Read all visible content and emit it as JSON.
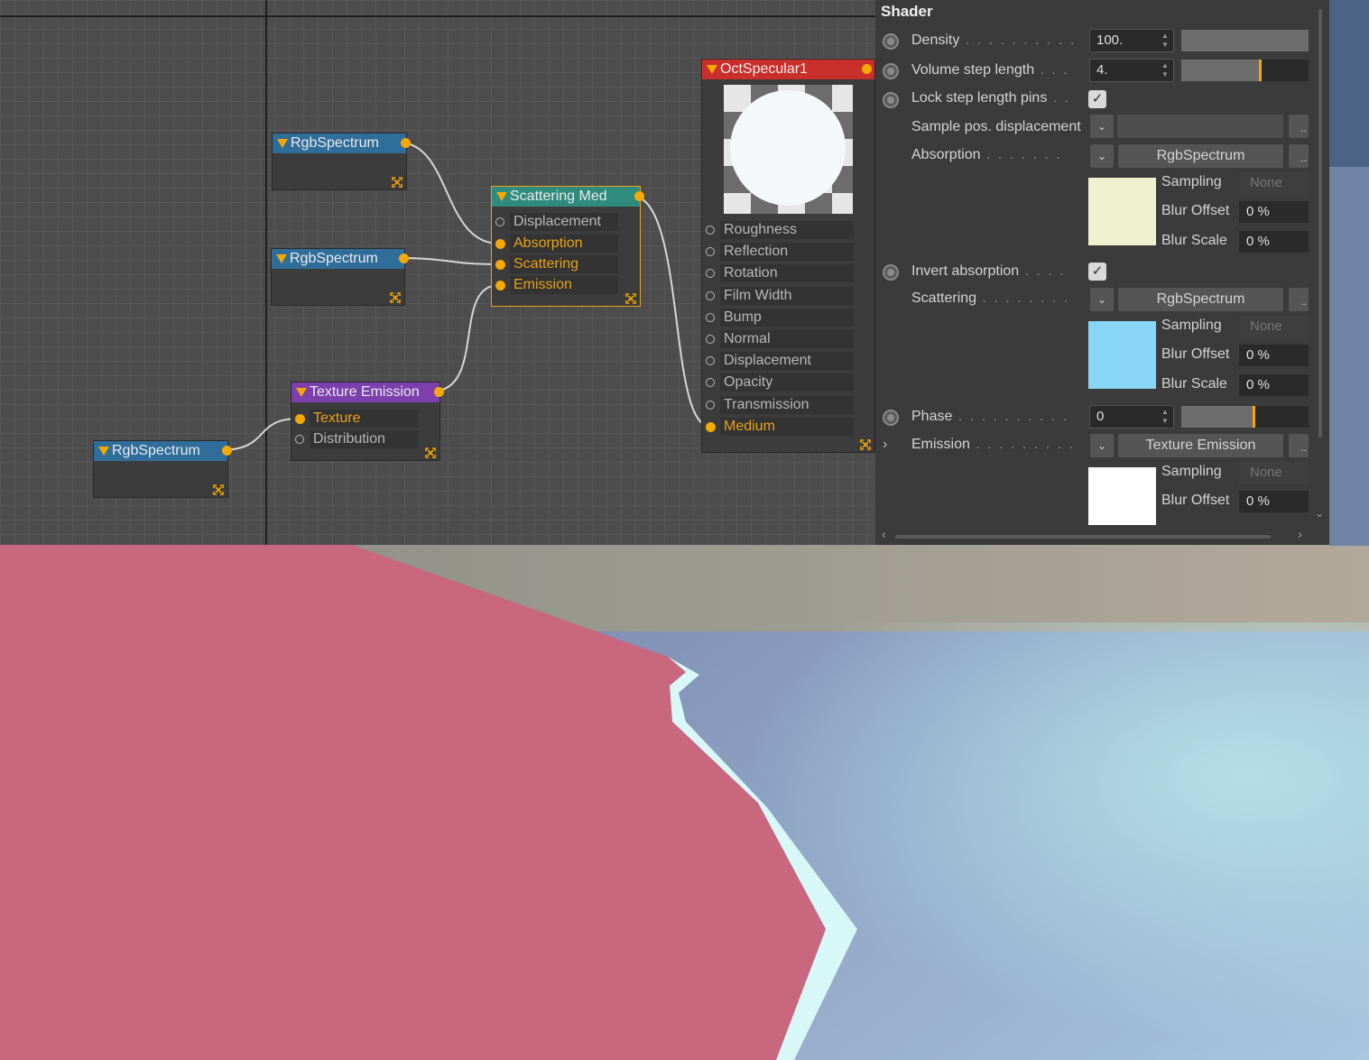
{
  "colors": {
    "accent_orange": "#f5a800",
    "render_pink": "#c8677e",
    "absorption_swatch": "#eef2d0",
    "scattering_swatch": "#87d6f7",
    "emission_swatch": "#ffffff"
  },
  "nodes": {
    "rgb1": {
      "title": "RgbSpectrum"
    },
    "rgb2": {
      "title": "RgbSpectrum"
    },
    "rgb3": {
      "title": "RgbSpectrum"
    },
    "texture_emission": {
      "title": "Texture Emission",
      "ports": [
        "Texture",
        "Distribution"
      ]
    },
    "scattering": {
      "title": "Scattering Med",
      "ports": [
        "Displacement",
        "Absorption",
        "Scattering",
        "Emission"
      ]
    },
    "specular": {
      "title": "OctSpecular1",
      "ports": [
        "Roughness",
        "Reflection",
        "Rotation",
        "Film Width",
        "Bump",
        "Normal",
        "Displacement",
        "Opacity",
        "Transmission",
        "Medium"
      ]
    }
  },
  "panel": {
    "title": "Shader",
    "density": {
      "label": "Density",
      "value": "100.",
      "fill": 1.0
    },
    "volume_step": {
      "label": "Volume step length",
      "value": "4.",
      "fill": 0.62
    },
    "lock_step": {
      "label": "Lock step length pins",
      "checked": "✓"
    },
    "sample_pos": {
      "label": "Sample pos. displacement"
    },
    "absorption": {
      "label": "Absorption",
      "button": "RgbSpectrum",
      "sampling_label": "Sampling",
      "sampling_value": "None",
      "blur_offset_label": "Blur Offset",
      "blur_offset_value": "0 %",
      "blur_scale_label": "Blur Scale",
      "blur_scale_value": "0 %"
    },
    "invert_absorption": {
      "label": "Invert absorption",
      "checked": "✓"
    },
    "scattering": {
      "label": "Scattering",
      "button": "RgbSpectrum",
      "sampling_label": "Sampling",
      "sampling_value": "None",
      "blur_offset_label": "Blur Offset",
      "blur_offset_value": "0 %",
      "blur_scale_label": "Blur Scale",
      "blur_scale_value": "0 %"
    },
    "phase": {
      "label": "Phase",
      "value": "0",
      "fill": 0.57
    },
    "emission": {
      "label": "Emission",
      "button": "Texture Emission",
      "sampling_label": "Sampling",
      "sampling_value": "None",
      "blur_offset_label": "Blur Offset",
      "blur_offset_value": "0 %"
    },
    "ellipsis": "..",
    "dots": ". . . . . ."
  }
}
